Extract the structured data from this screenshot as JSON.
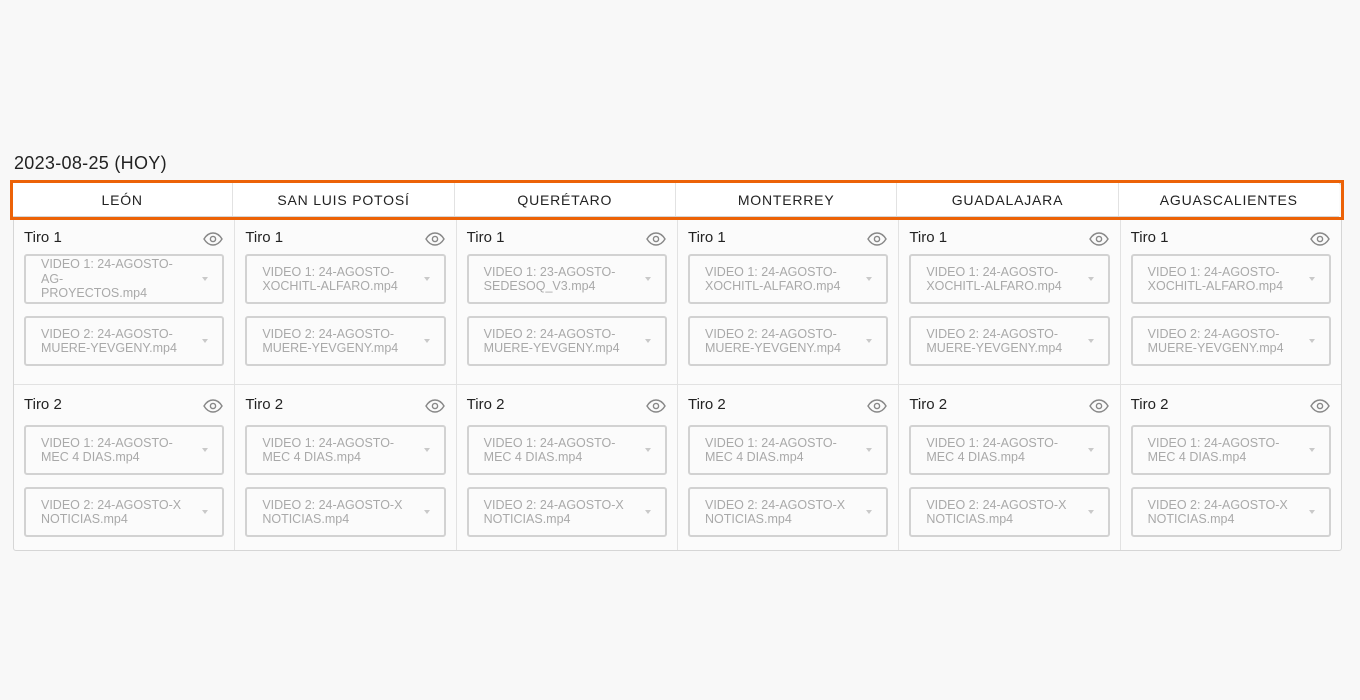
{
  "date_heading": "2023-08-25 (HOY)",
  "accent_color": "#ec6207",
  "cities": [
    {
      "name": "LEÓN",
      "tiros": [
        {
          "label": "Tiro 1",
          "video1": "VIDEO 1: 24-AGOSTO-AG-\nPROYECTOS.mp4",
          "video2": "VIDEO 2: 24-AGOSTO-\nMUERE-YEVGENY.mp4"
        },
        {
          "label": "Tiro 2",
          "video1": "VIDEO 1: 24-AGOSTO-\nMEC 4 DIAS.mp4",
          "video2": "VIDEO 2: 24-AGOSTO-X\nNOTICIAS.mp4"
        }
      ]
    },
    {
      "name": "SAN LUIS POTOSÍ",
      "tiros": [
        {
          "label": "Tiro 1",
          "video1": "VIDEO 1: 24-AGOSTO-\nXOCHITL-ALFARO.mp4",
          "video2": "VIDEO 2: 24-AGOSTO-\nMUERE-YEVGENY.mp4"
        },
        {
          "label": "Tiro 2",
          "video1": "VIDEO 1: 24-AGOSTO-\nMEC 4 DIAS.mp4",
          "video2": "VIDEO 2: 24-AGOSTO-X\nNOTICIAS.mp4"
        }
      ]
    },
    {
      "name": "QUERÉTARO",
      "tiros": [
        {
          "label": "Tiro 1",
          "video1": "VIDEO 1: 23-AGOSTO-\nSEDESOQ_V3.mp4",
          "video2": "VIDEO 2: 24-AGOSTO-\nMUERE-YEVGENY.mp4"
        },
        {
          "label": "Tiro 2",
          "video1": "VIDEO 1: 24-AGOSTO-\nMEC 4 DIAS.mp4",
          "video2": "VIDEO 2: 24-AGOSTO-X\nNOTICIAS.mp4"
        }
      ]
    },
    {
      "name": "MONTERREY",
      "tiros": [
        {
          "label": "Tiro 1",
          "video1": "VIDEO 1: 24-AGOSTO-\nXOCHITL-ALFARO.mp4",
          "video2": "VIDEO 2: 24-AGOSTO-\nMUERE-YEVGENY.mp4"
        },
        {
          "label": "Tiro 2",
          "video1": "VIDEO 1: 24-AGOSTO-\nMEC 4 DIAS.mp4",
          "video2": "VIDEO 2: 24-AGOSTO-X\nNOTICIAS.mp4"
        }
      ]
    },
    {
      "name": "GUADALAJARA",
      "tiros": [
        {
          "label": "Tiro 1",
          "video1": "VIDEO 1: 24-AGOSTO-\nXOCHITL-ALFARO.mp4",
          "video2": "VIDEO 2: 24-AGOSTO-\nMUERE-YEVGENY.mp4"
        },
        {
          "label": "Tiro 2",
          "video1": "VIDEO 1: 24-AGOSTO-\nMEC 4 DIAS.mp4",
          "video2": "VIDEO 2: 24-AGOSTO-X\nNOTICIAS.mp4"
        }
      ]
    },
    {
      "name": "AGUASCALIENTES",
      "tiros": [
        {
          "label": "Tiro 1",
          "video1": "VIDEO 1: 24-AGOSTO-\nXOCHITL-ALFARO.mp4",
          "video2": "VIDEO 2: 24-AGOSTO-\nMUERE-YEVGENY.mp4"
        },
        {
          "label": "Tiro 2",
          "video1": "VIDEO 1: 24-AGOSTO-\nMEC 4 DIAS.mp4",
          "video2": "VIDEO 2: 24-AGOSTO-X\nNOTICIAS.mp4"
        }
      ]
    }
  ]
}
